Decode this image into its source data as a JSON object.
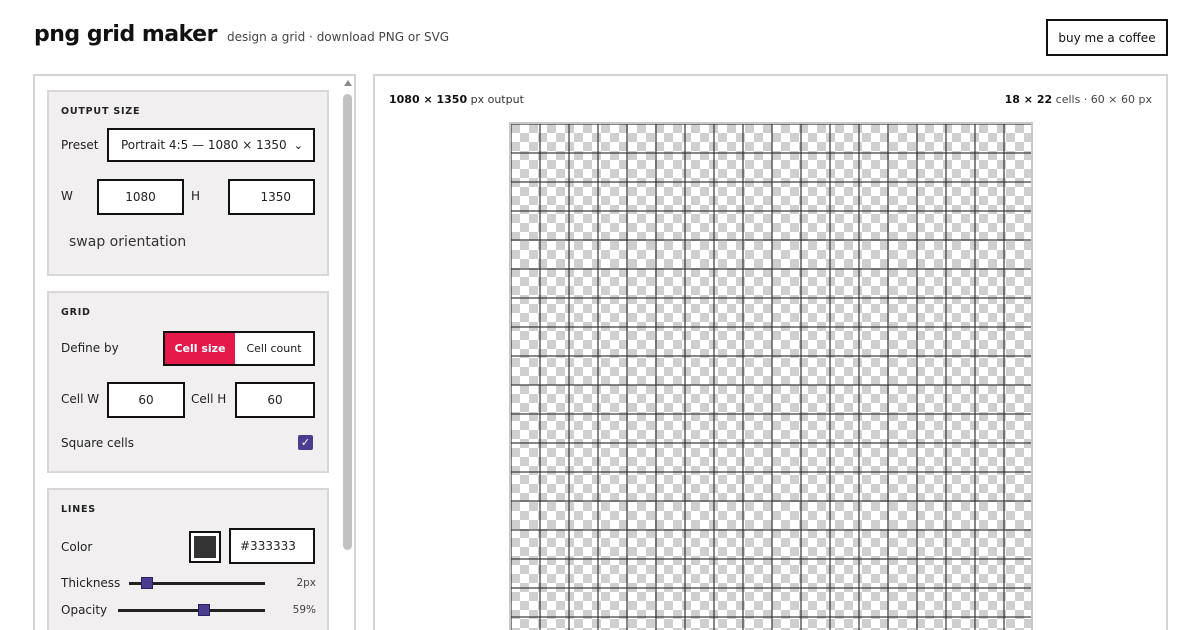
{
  "header": {
    "title": "png grid maker",
    "tagline": "design a grid · download PNG or SVG",
    "coffee_label": "buy me a coffee"
  },
  "output_size": {
    "title": "OUTPUT SIZE",
    "preset_label": "Preset",
    "preset_value": "Portrait 4:5 — 1080 × 1350",
    "w_label": "W",
    "w_value": "1080",
    "h_label": "H",
    "h_value": "1350",
    "swap_label": "swap orientation"
  },
  "grid": {
    "title": "GRID",
    "define_by_label": "Define by",
    "options": [
      "Cell size",
      "Cell count"
    ],
    "selected_option": "Cell size",
    "cell_w_label": "Cell W",
    "cell_w_value": "60",
    "cell_h_label": "Cell H",
    "cell_h_value": "60",
    "square_label": "Square cells",
    "square_checked": true
  },
  "lines": {
    "title": "LINES",
    "color_label": "Color",
    "color_value": "#333333",
    "thickness_label": "Thickness",
    "thickness_value": "2px",
    "thickness_fraction": 0.1,
    "opacity_label": "Opacity",
    "opacity_value": "59%",
    "opacity_fraction": 0.59
  },
  "preview": {
    "size_bold": "1080 × 1350",
    "size_suffix": "px output",
    "cells_bold": "18 × 22",
    "cells_suffix": "cells · 60 × 60 px",
    "columns": 18,
    "rows": 22
  },
  "colors": {
    "accent": "#e6194b",
    "control": "#4b3c8f",
    "line": "#333333"
  }
}
